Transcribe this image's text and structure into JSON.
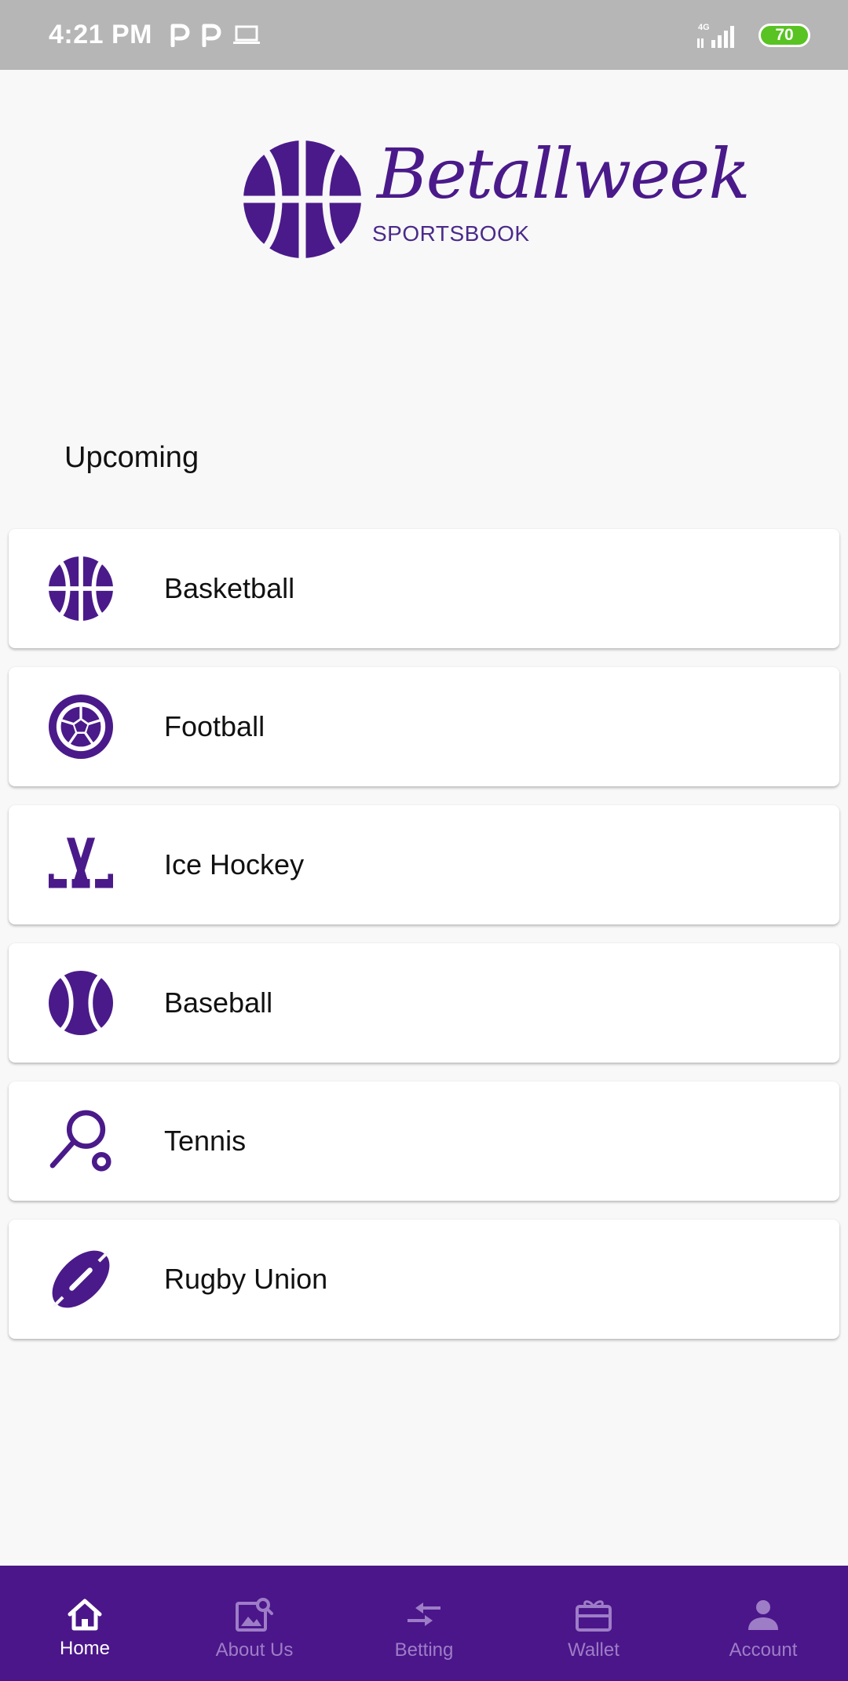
{
  "status_bar": {
    "time": "4:21 PM",
    "network": "4G",
    "battery": "70",
    "icons": [
      "parking-icon",
      "parking-icon",
      "laptop-icon",
      "signal-icon",
      "battery-icon"
    ]
  },
  "brand": {
    "name": "Betallweek",
    "tagline": "SPORTSBOOK",
    "color": "#4a1a8a"
  },
  "section": {
    "title": "Upcoming"
  },
  "sports": [
    {
      "label": "Basketball",
      "icon": "basketball-icon"
    },
    {
      "label": "Football",
      "icon": "soccer-ball-icon"
    },
    {
      "label": "Ice Hockey",
      "icon": "hockey-sticks-icon"
    },
    {
      "label": "Baseball",
      "icon": "baseball-icon"
    },
    {
      "label": "Tennis",
      "icon": "tennis-racket-icon"
    },
    {
      "label": "Rugby Union",
      "icon": "rugby-ball-icon"
    }
  ],
  "nav": {
    "items": [
      {
        "label": "Home",
        "icon": "home-icon",
        "active": true
      },
      {
        "label": "About Us",
        "icon": "image-search-icon",
        "active": false
      },
      {
        "label": "Betting",
        "icon": "arrows-icon",
        "active": false
      },
      {
        "label": "Wallet",
        "icon": "gift-card-icon",
        "active": false
      },
      {
        "label": "Account",
        "icon": "person-icon",
        "active": false
      }
    ],
    "background": "#4b168a",
    "active_color": "#ffffff",
    "inactive_color": "#9e7dc7"
  },
  "colors": {
    "accent": "#4a1a8a",
    "status_bar": "#b6b6b6",
    "battery": "#58c322"
  }
}
